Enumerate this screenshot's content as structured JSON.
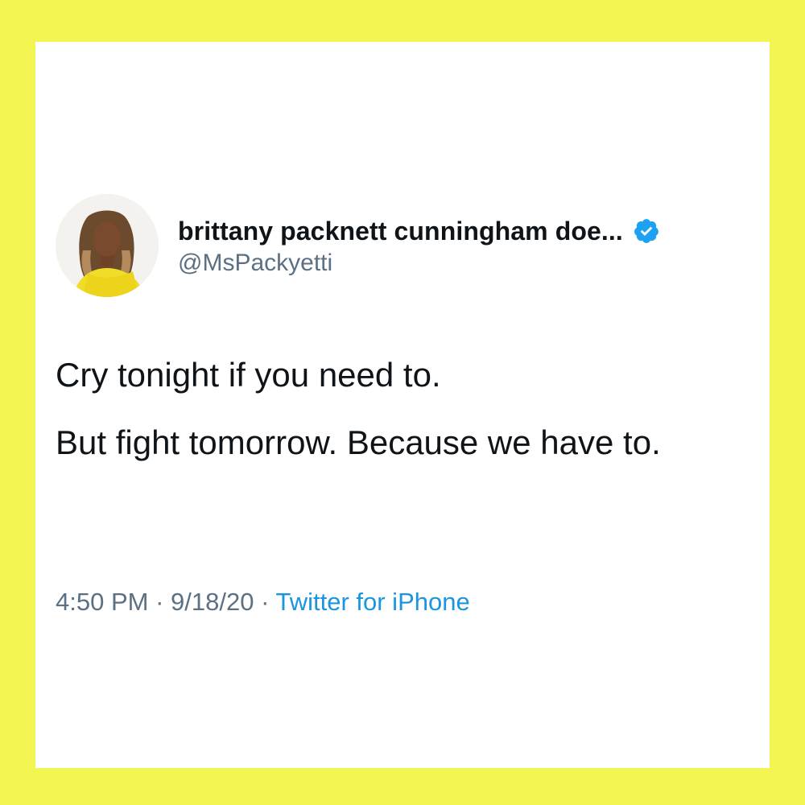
{
  "tweet": {
    "author": {
      "display_name": "brittany packnett cunningham doe...",
      "handle": "@MsPackyetti",
      "verified": true,
      "avatar": "profile-photo"
    },
    "paragraphs": [
      "Cry tonight if you need to.",
      "But fight tomorrow. Because we have to."
    ],
    "time": "4:50 PM",
    "separator": "·",
    "date": "9/18/20",
    "source": "Twitter for iPhone"
  },
  "colors": {
    "background_frame": "#f2f552",
    "card": "#ffffff",
    "text_primary": "#0f1419",
    "text_secondary": "#5b7083",
    "link": "#1b95e0",
    "verified_badge": "#1da1f2"
  },
  "icons": {
    "verified": "verified-badge-icon"
  }
}
